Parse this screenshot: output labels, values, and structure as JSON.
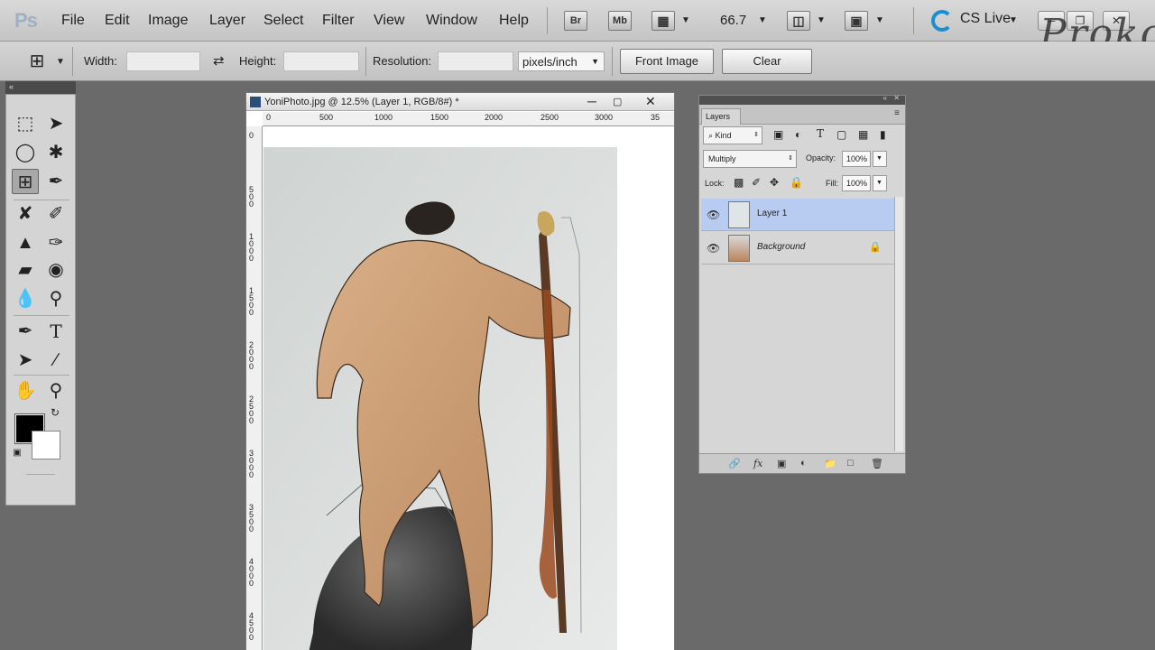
{
  "app": {
    "logo": "Ps",
    "watermark": "Proko"
  },
  "menu": [
    "File",
    "Edit",
    "Image",
    "Layer",
    "Select",
    "Filter",
    "View",
    "Window",
    "Help"
  ],
  "menubar": {
    "bridge_label": "Br",
    "minibridge_label": "Mb",
    "zoom_value": "66.7",
    "cslive_label": "CS Live"
  },
  "options": {
    "width_label": "Width:",
    "width_value": "",
    "height_label": "Height:",
    "height_value": "",
    "resolution_label": "Resolution:",
    "resolution_value": "",
    "resolution_unit": "pixels/inch",
    "front_image_label": "Front Image",
    "clear_label": "Clear"
  },
  "tools": {
    "icons": [
      "marquee-icon",
      "move-icon",
      "lasso-icon",
      "magic-wand-icon",
      "crop-icon",
      "eyedropper-icon",
      "healing-brush-icon",
      "brush-icon",
      "clone-stamp-icon",
      "history-brush-icon",
      "eraser-icon",
      "paint-bucket-icon",
      "blur-icon",
      "dodge-icon",
      "pen-icon",
      "type-icon",
      "path-selection-icon",
      "line-icon",
      "hand-icon",
      "zoom-icon"
    ],
    "foreground_color": "#000000",
    "background_color": "#ffffff",
    "active_tool": "crop-icon"
  },
  "document": {
    "title": "YoniPhoto.jpg @ 12.5% (Layer 1, RGB/8#) *",
    "ruler_h": [
      "0",
      "500",
      "1000",
      "1500",
      "2000",
      "2500",
      "3000",
      "35"
    ],
    "ruler_v": [
      "0",
      "5 0 0",
      "1 0 0 0",
      "1 5 0 0",
      "2 0 0 0",
      "2 5 0 0",
      "3 0 0 0",
      "3 5 0 0",
      "4 0 0 0",
      "4 5 0 0"
    ]
  },
  "layers_panel": {
    "tab_label": "Layers",
    "filter_kind": "⌕ Kind",
    "blend_mode": "Multiply",
    "opacity_label": "Opacity:",
    "opacity_value": "100%",
    "lock_label": "Lock:",
    "fill_label": "Fill:",
    "fill_value": "100%",
    "layers": [
      {
        "name": "Layer 1",
        "visible": true,
        "selected": true,
        "locked": false
      },
      {
        "name": "Background",
        "visible": true,
        "selected": false,
        "locked": true
      }
    ]
  },
  "colors": {
    "accent_selection": "#b8ccf2",
    "cslive_blue": "#1a8fd0"
  }
}
